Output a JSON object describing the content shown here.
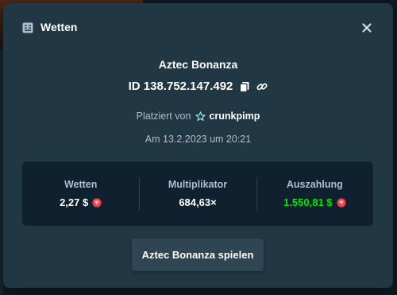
{
  "modal": {
    "title": "Wetten",
    "header_icon": "bet-slip-icon",
    "close_icon": "close-icon"
  },
  "bet": {
    "game_name": "Aztec Bonanza",
    "id_text": "ID 138.752.147.492",
    "placed_by_label": "Platziert von",
    "username": "crunkpimp",
    "date_text": "Am 13.2.2023 um 20:21"
  },
  "stats": [
    {
      "label": "Wetten",
      "value": "2,27 $",
      "coin": true,
      "color": "#ffffff"
    },
    {
      "label": "Multiplikator",
      "value": "684,63×",
      "coin": false,
      "color": "#ffffff"
    },
    {
      "label": "Auszahlung",
      "value": "1.550,81 $",
      "coin": true,
      "color": "#00e701"
    }
  ],
  "actions": {
    "play_label": "Aztec Bonanza spielen"
  },
  "colors": {
    "modal_bg": "#213743",
    "stats_bg": "#0f212e",
    "muted_text": "#b1bad3",
    "payout_green": "#00e701",
    "vip_star": "#8ee6f2",
    "coin_red": "#ee3f4d"
  }
}
